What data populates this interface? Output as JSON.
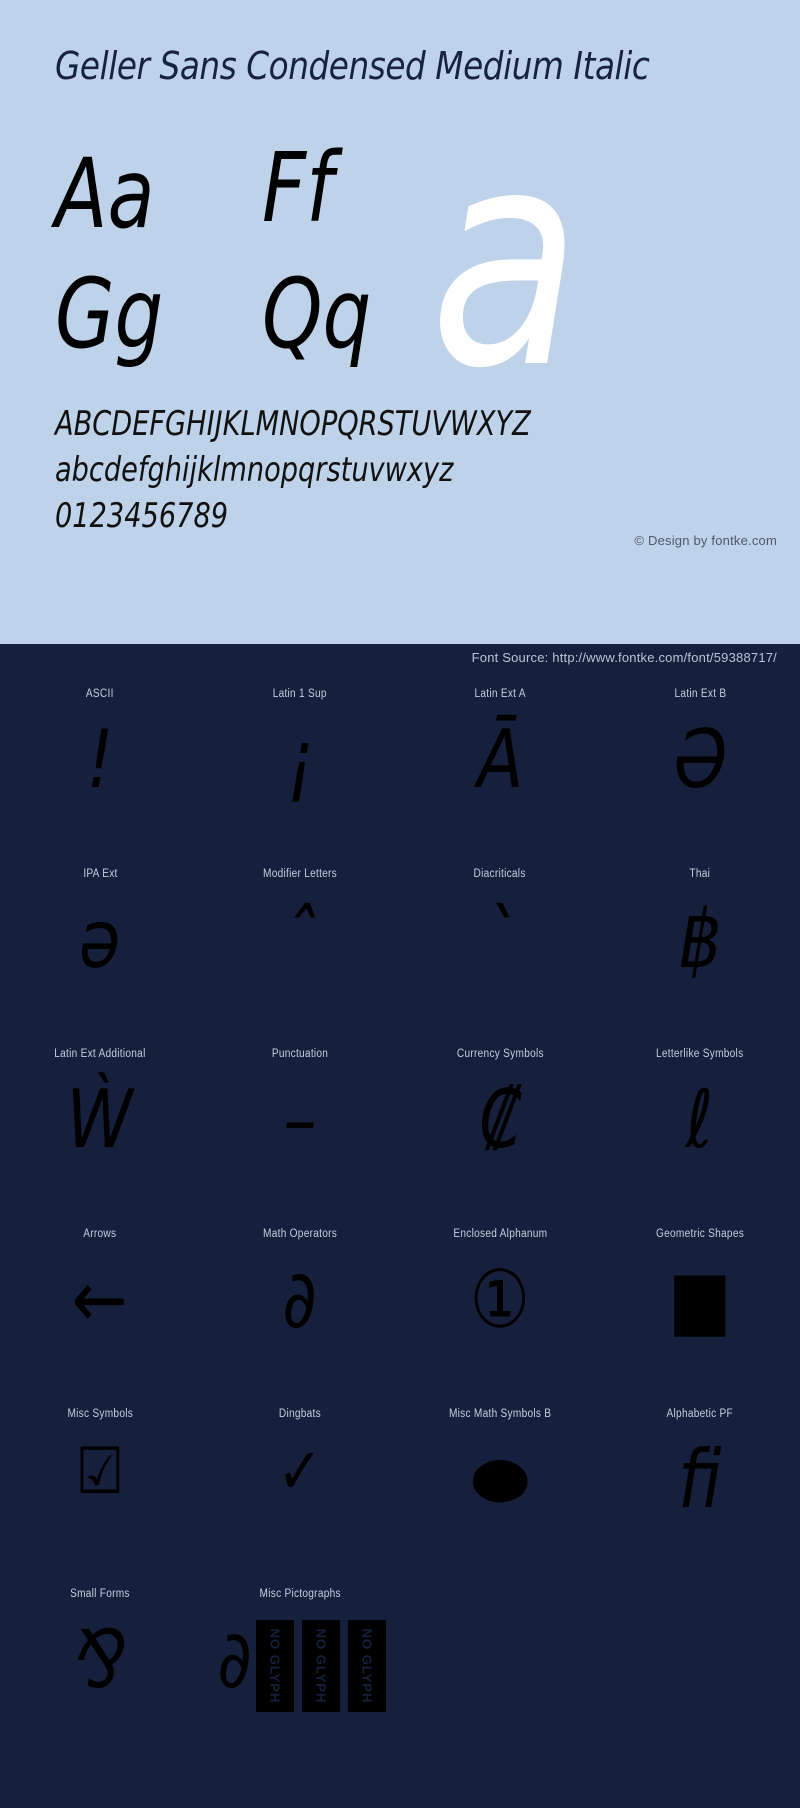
{
  "page": {
    "title": "Geller Sans Condensed Medium Italic",
    "bg_light": "#bed2e9",
    "bg_dark": "#16203c",
    "text_dark": "#17223f",
    "glyph_color": "#000000",
    "highlight_color": "#ffffff"
  },
  "specimen": {
    "title": "Geller Sans Condensed Medium Italic",
    "pairs": [
      {
        "name": "a-pair",
        "text": "Aa"
      },
      {
        "name": "f-pair",
        "text": "Ff"
      },
      {
        "name": "g-pair",
        "text": "Gg"
      },
      {
        "name": "q-pair",
        "text": "Qq"
      }
    ],
    "big_letter": "a",
    "uppercase": "ABCDEFGHIJKLMNOPQRSTUVWXYZ",
    "lowercase": "abcdefghijklmnopqrstuvwxyz",
    "digits": "0123456789",
    "credit": "© Design by fontke.com"
  },
  "source": {
    "label": "Font Source: http://www.fontke.com/font/59388717/"
  },
  "unicode_blocks": {
    "rows": [
      [
        {
          "label": "ASCII",
          "glyph": "!",
          "style": "italic"
        },
        {
          "label": "Latin 1 Sup",
          "glyph": "¡",
          "style": "italic"
        },
        {
          "label": "Latin Ext A",
          "glyph": "Ā",
          "style": "italic"
        },
        {
          "label": "Latin Ext B",
          "glyph": "Ə",
          "style": "italic"
        }
      ],
      [
        {
          "label": "IPA Ext",
          "glyph": "ə",
          "style": "italic"
        },
        {
          "label": "Modifier Letters",
          "glyph": "ˆ",
          "style": "italic"
        },
        {
          "label": "Diacriticals",
          "glyph": "ˋ",
          "style": "italic"
        },
        {
          "label": "Thai",
          "glyph": "฿",
          "style": "italic"
        }
      ],
      [
        {
          "label": "Latin Ext Additional",
          "glyph": "Ẁ",
          "style": "italic"
        },
        {
          "label": "Punctuation",
          "glyph": "–",
          "style": "italic"
        },
        {
          "label": "Currency Symbols",
          "glyph": "₡",
          "style": "italic"
        },
        {
          "label": "Letterlike Symbols",
          "glyph": "ℓ",
          "style": "italic"
        }
      ],
      [
        {
          "label": "Arrows",
          "glyph": "←",
          "style": "normal"
        },
        {
          "label": "Math Operators",
          "glyph": "∂",
          "style": "italic"
        },
        {
          "label": "Enclosed Alphanum",
          "glyph": "①",
          "style": "normal"
        },
        {
          "label": "Geometric Shapes",
          "glyph": "■",
          "style": "normal"
        }
      ],
      [
        {
          "label": "Misc Symbols",
          "glyph": "☑",
          "style": "normal"
        },
        {
          "label": "Dingbats",
          "glyph": "✓",
          "style": "normal"
        },
        {
          "label": "Misc Math Symbols B",
          "glyph": "⬬",
          "style": "normal"
        },
        {
          "label": "Alphabetic PF",
          "glyph": "ﬁ",
          "style": "italic"
        }
      ]
    ],
    "last_row": {
      "cells": [
        {
          "label": "Small Forms",
          "glyph": "⅋",
          "style": "italic"
        },
        {
          "label": "Misc Pictographs",
          "glyph": "∂",
          "style": "italic"
        }
      ],
      "no_glyph_label": "NO GLYPH",
      "no_glyph_count": 3
    }
  }
}
